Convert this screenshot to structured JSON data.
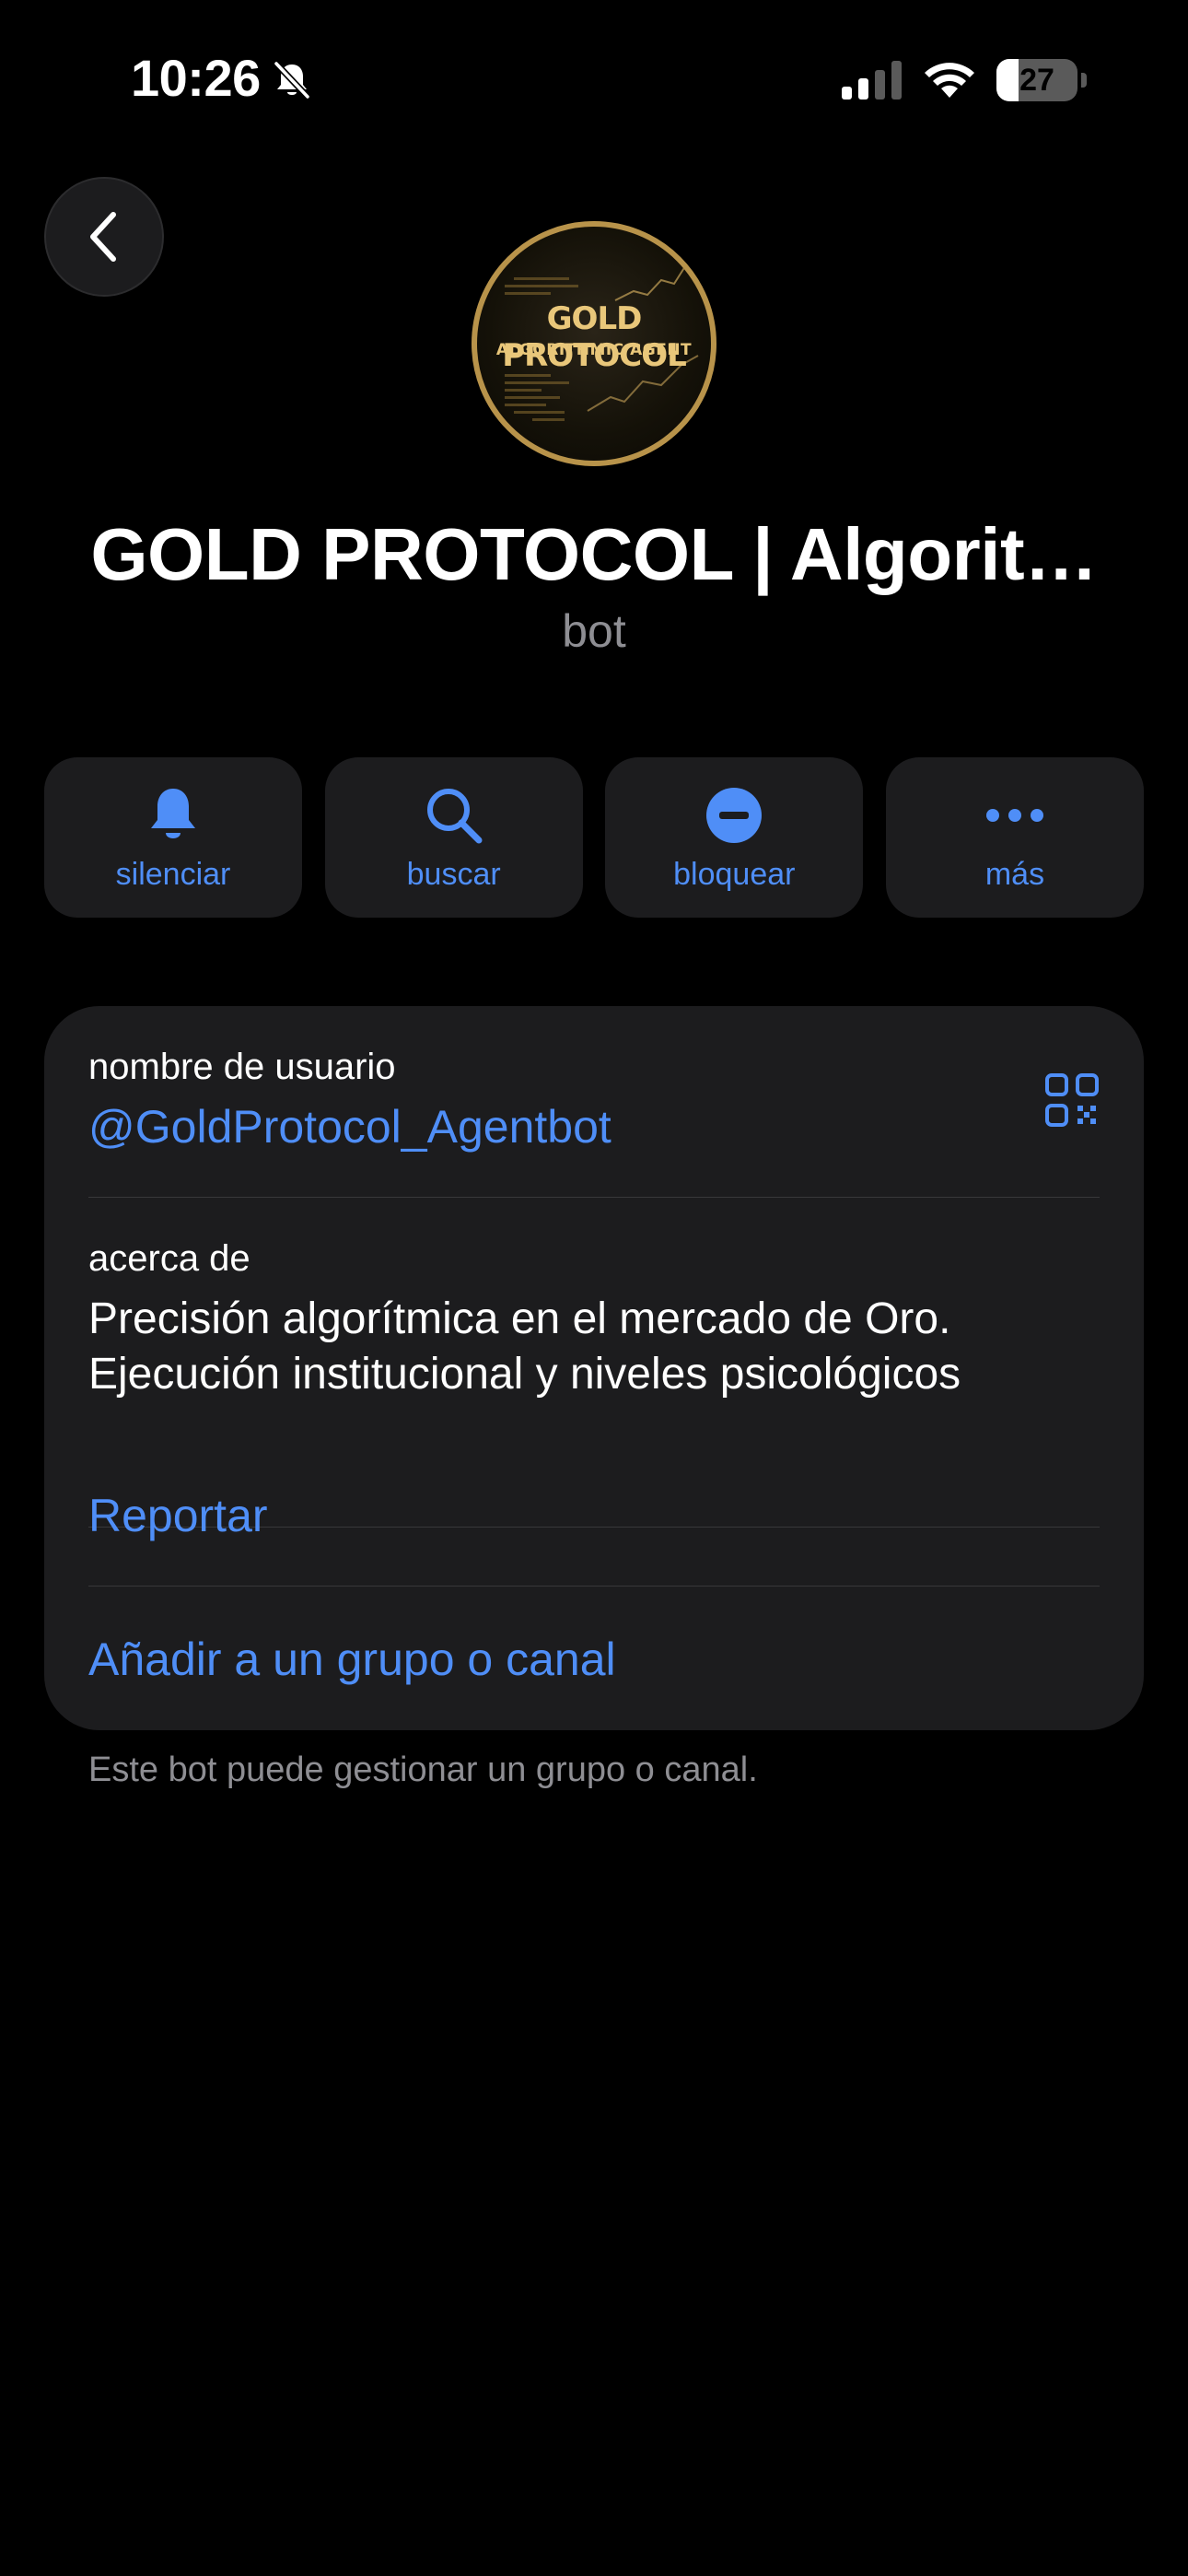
{
  "status_bar": {
    "time": "10:26",
    "battery_level": "27",
    "battery_fraction": 0.27,
    "icons": [
      "bell-slash-icon",
      "cellular-signal-icon",
      "wifi-icon",
      "battery-icon"
    ]
  },
  "nav": {
    "back_icon": "chevron-left-icon"
  },
  "avatar": {
    "title": "GOLD PROTOCOL",
    "subtitle": "ALGORITHMIC AGENT",
    "accent_color": "#e9c77a"
  },
  "profile": {
    "name": "GOLD PROTOCOL | Algorit…",
    "subtitle": "bot"
  },
  "actions": [
    {
      "label": "silenciar",
      "icon": "bell-icon"
    },
    {
      "label": "buscar",
      "icon": "search-icon"
    },
    {
      "label": "bloquear",
      "icon": "block-icon"
    },
    {
      "label": "más",
      "icon": "more-icon"
    }
  ],
  "info": {
    "username_label": "nombre de usuario",
    "username_value": "@GoldProtocol_Agentbot",
    "qr_icon": "qr-code-icon",
    "about_label": "acerca de",
    "about_line1": "Precisión algorítmica en el mercado de Oro.",
    "about_line2": "Ejecución institucional y niveles psicológicos",
    "report_label": "Reportar",
    "add_label": "Añadir a un grupo o canal"
  },
  "footer_note": "Este bot puede gestionar un grupo o canal.",
  "colors": {
    "background": "#000000",
    "card": "#1c1c1e",
    "accent": "#4f8ef7",
    "secondary_text": "#8e8e93",
    "separator": "#38383a"
  }
}
